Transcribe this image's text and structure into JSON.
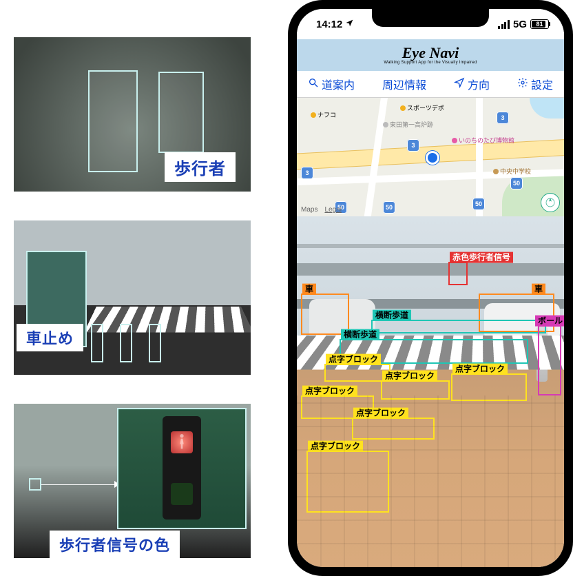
{
  "left_thumbnails": {
    "pedestrian": {
      "label": "歩行者"
    },
    "bollard": {
      "label": "車止め"
    },
    "signal": {
      "label": "歩行者信号の色"
    }
  },
  "phone": {
    "status": {
      "time": "14:12",
      "network": "5G",
      "battery": "81"
    },
    "app": {
      "title": "Eye Navi",
      "subtitle": "Walking Support App for the Visually Impaired"
    },
    "nav": {
      "route": "道案内",
      "nearby": "周辺情報",
      "direction": "方向",
      "settings": "設定"
    },
    "map": {
      "credit_source": "Maps",
      "credit_legal": "Legal",
      "shields": [
        "3",
        "50",
        "50",
        "50",
        "50",
        "3",
        "3"
      ],
      "pois": {
        "nafco": "ナフコ",
        "sports": "スポーツデポ",
        "higashida": "東田第一高炉跡",
        "inochi": "いのちのたび博物館",
        "chuo": "中央中学校"
      }
    },
    "camera_labels": {
      "car": "車",
      "crosswalk": "横断歩道",
      "red_ped_signal": "赤色歩行者信号",
      "bollard": "ボール",
      "tactile": "点字ブロック"
    }
  }
}
